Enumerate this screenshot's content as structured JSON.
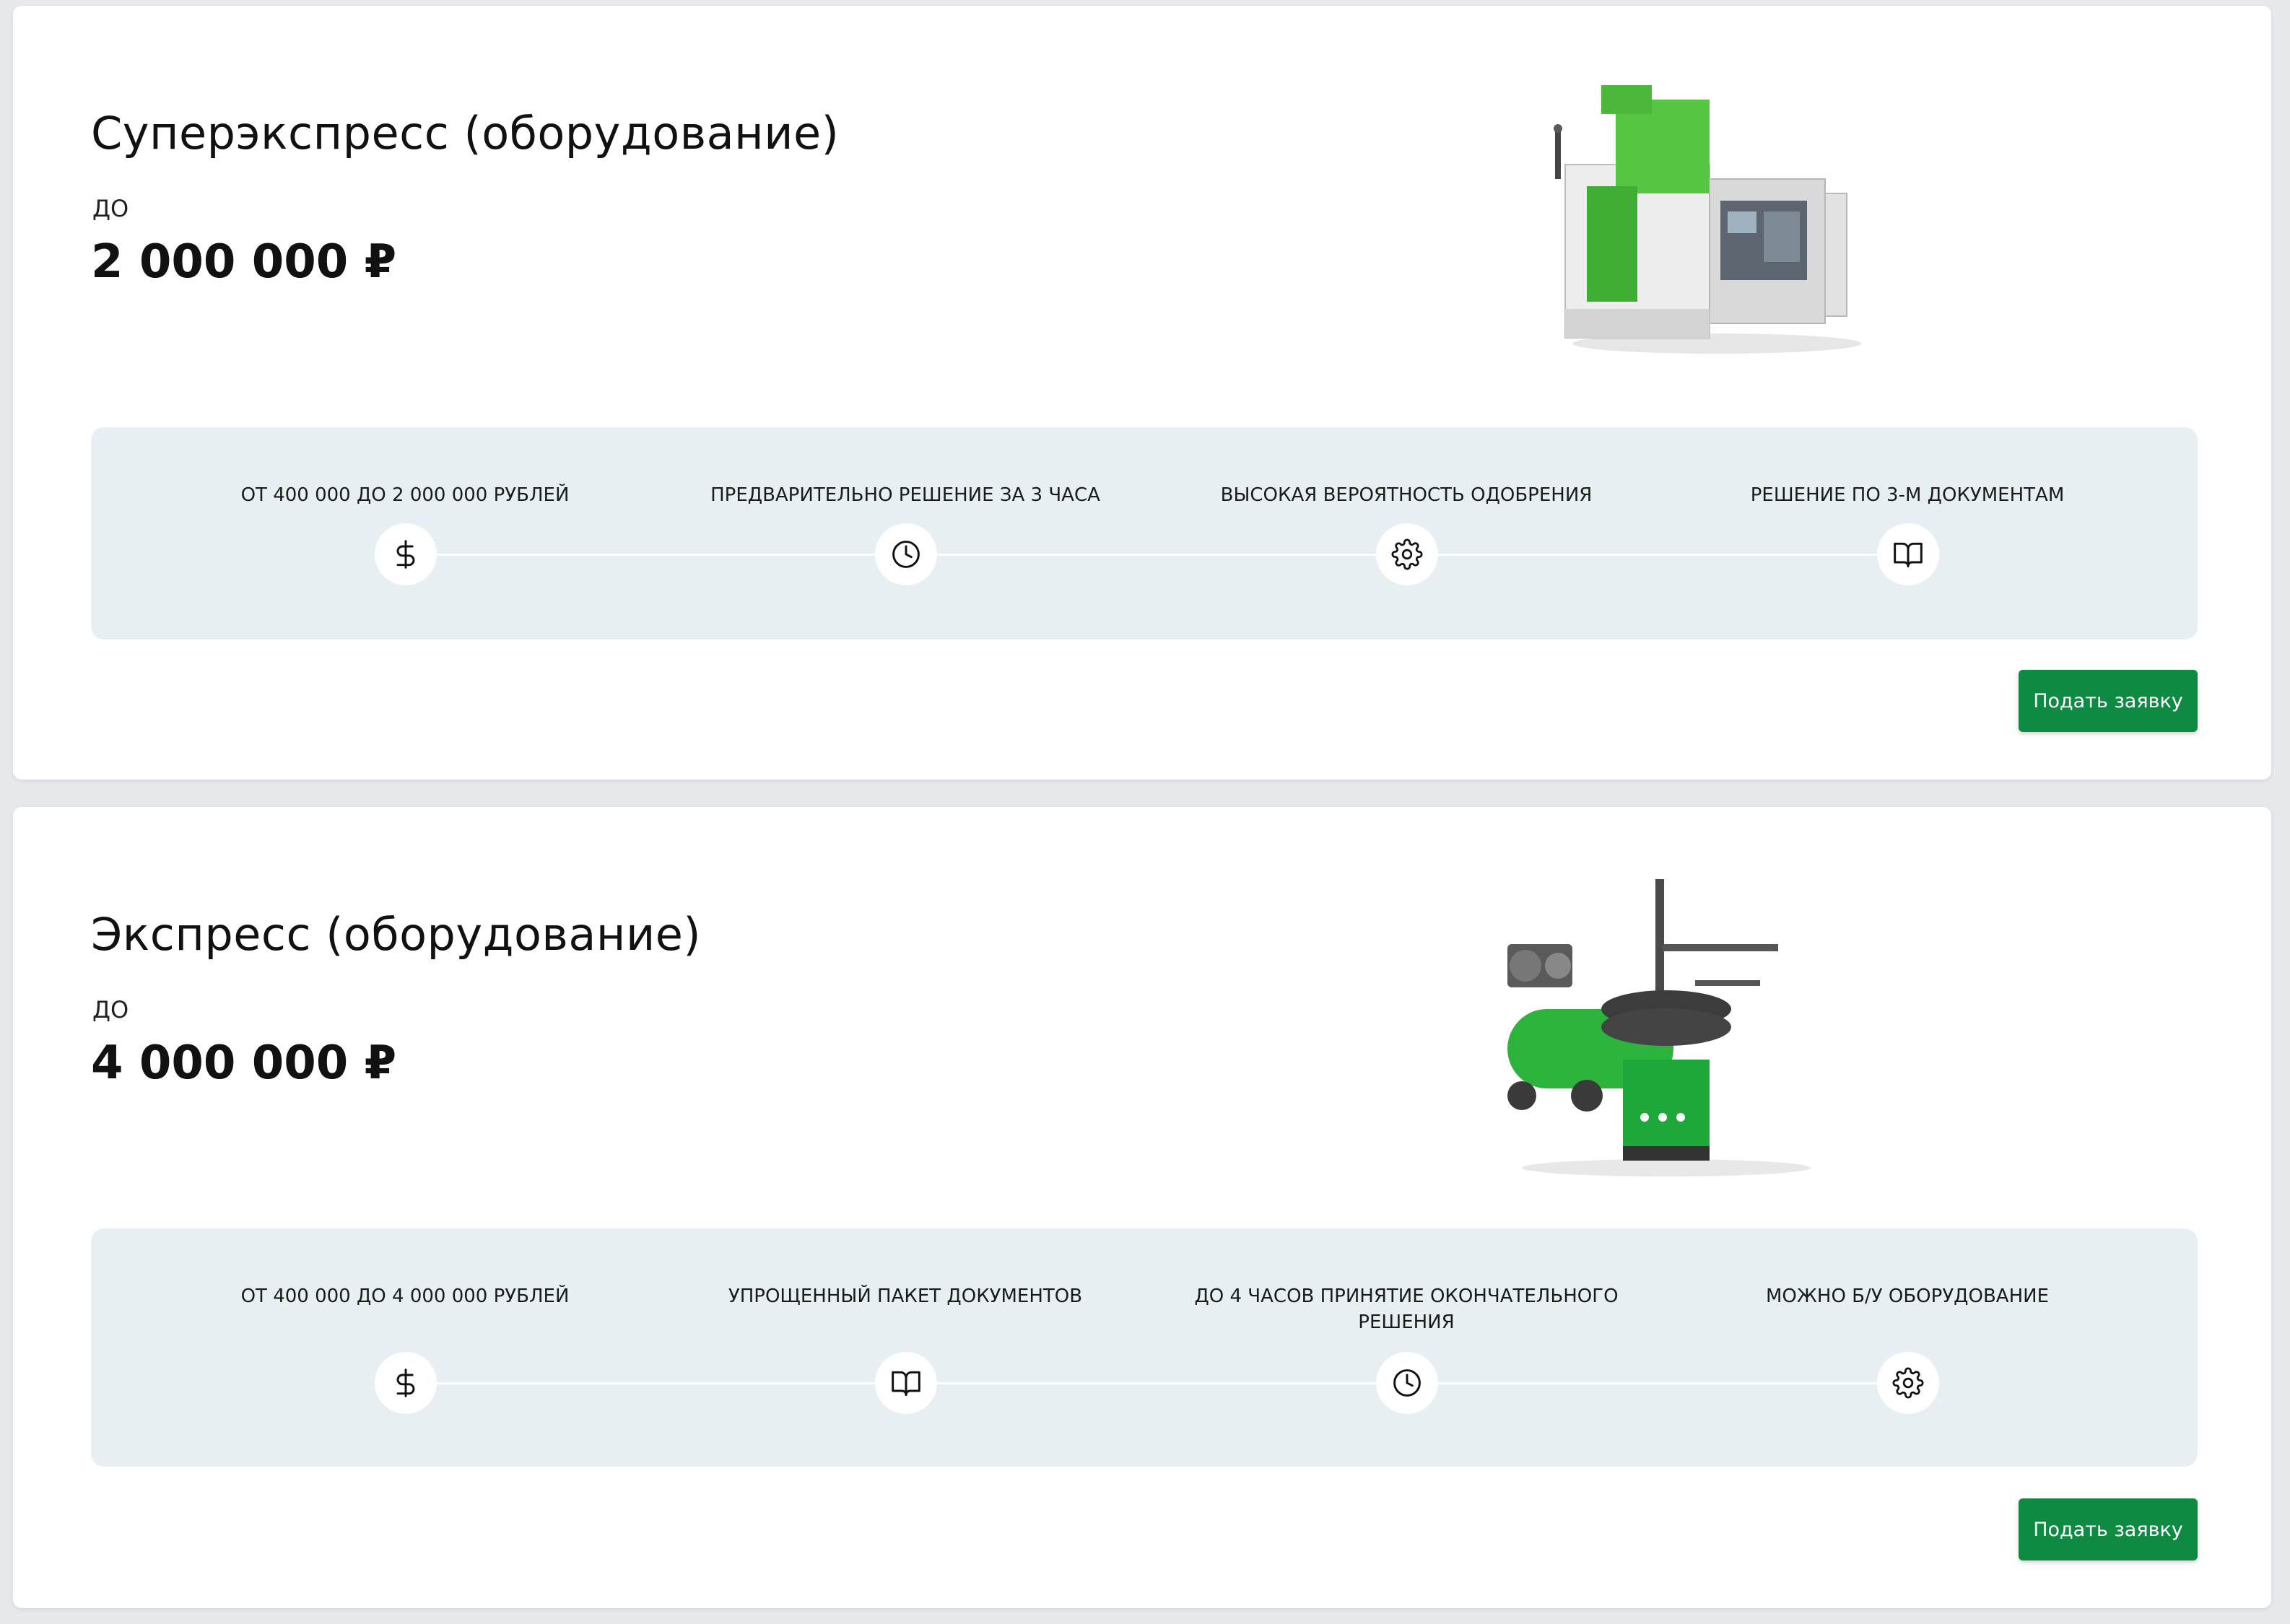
{
  "products": [
    {
      "title": "Суперэкспресс (оборудование)",
      "prefix": "ДО",
      "amount": "2 000 000 ₽",
      "features": [
        {
          "label": "ОТ 400 000 ДО 2 000 000 РУБЛЕЙ",
          "icon": "dollar-icon"
        },
        {
          "label": "ПРЕДВАРИТЕЛЬНО РЕШЕНИЕ ЗА 3 ЧАСА",
          "icon": "clock-icon"
        },
        {
          "label": "ВЫСОКАЯ ВЕРОЯТНОСТЬ ОДОБРЕНИЯ",
          "icon": "gear-icon"
        },
        {
          "label": "РЕШЕНИЕ ПО 3-М ДОКУМЕНТАМ",
          "icon": "book-icon"
        }
      ],
      "apply_label": "Подать заявку"
    },
    {
      "title": "Экспресс (оборудование)",
      "prefix": "ДО",
      "amount": "4 000 000 ₽",
      "features": [
        {
          "label": "ОТ 400 000 ДО 4 000 000 РУБЛЕЙ",
          "icon": "dollar-icon"
        },
        {
          "label": "УПРОЩЕННЫЙ ПАКЕТ ДОКУМЕНТОВ",
          "icon": "book-icon"
        },
        {
          "label": "ДО 4 ЧАСОВ ПРИНЯТИЕ ОКОНЧАТЕЛЬНОГО РЕШЕНИЯ",
          "icon": "clock-icon"
        },
        {
          "label": "МОЖНО Б/У ОБОРУДОВАНИЕ",
          "icon": "gear-icon"
        }
      ],
      "apply_label": "Подать заявку"
    }
  ],
  "colors": {
    "accent": "#0f8a42",
    "panel": "#e8eff2",
    "page_background": "#e6e8ec"
  }
}
